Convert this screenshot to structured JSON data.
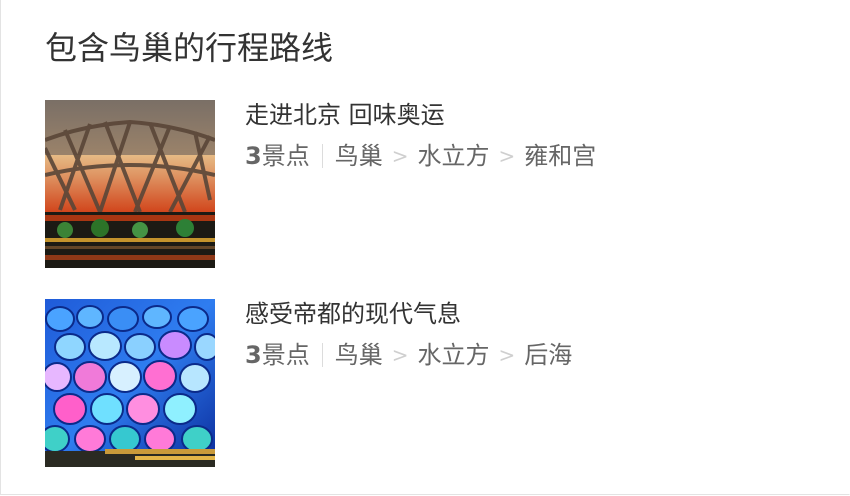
{
  "section": {
    "title": "包含鸟巢的行程路线"
  },
  "routes": [
    {
      "name": "走进北京 回味奥运",
      "count": "3",
      "count_unit": "景点",
      "stops": [
        "鸟巢",
        "水立方",
        "雍和宫"
      ],
      "image": "birds-nest-stadium-photo"
    },
    {
      "name": "感受帝都的现代气息",
      "count": "3",
      "count_unit": "景点",
      "stops": [
        "鸟巢",
        "水立方",
        "后海"
      ],
      "image": "water-cube-photo"
    }
  ],
  "separators": {
    "pipe": "|",
    "arrow": ">"
  },
  "colors": {
    "title": "#333333",
    "meta": "#666666",
    "arrow": "#cfcfcf",
    "border": "#e3e3e3"
  }
}
